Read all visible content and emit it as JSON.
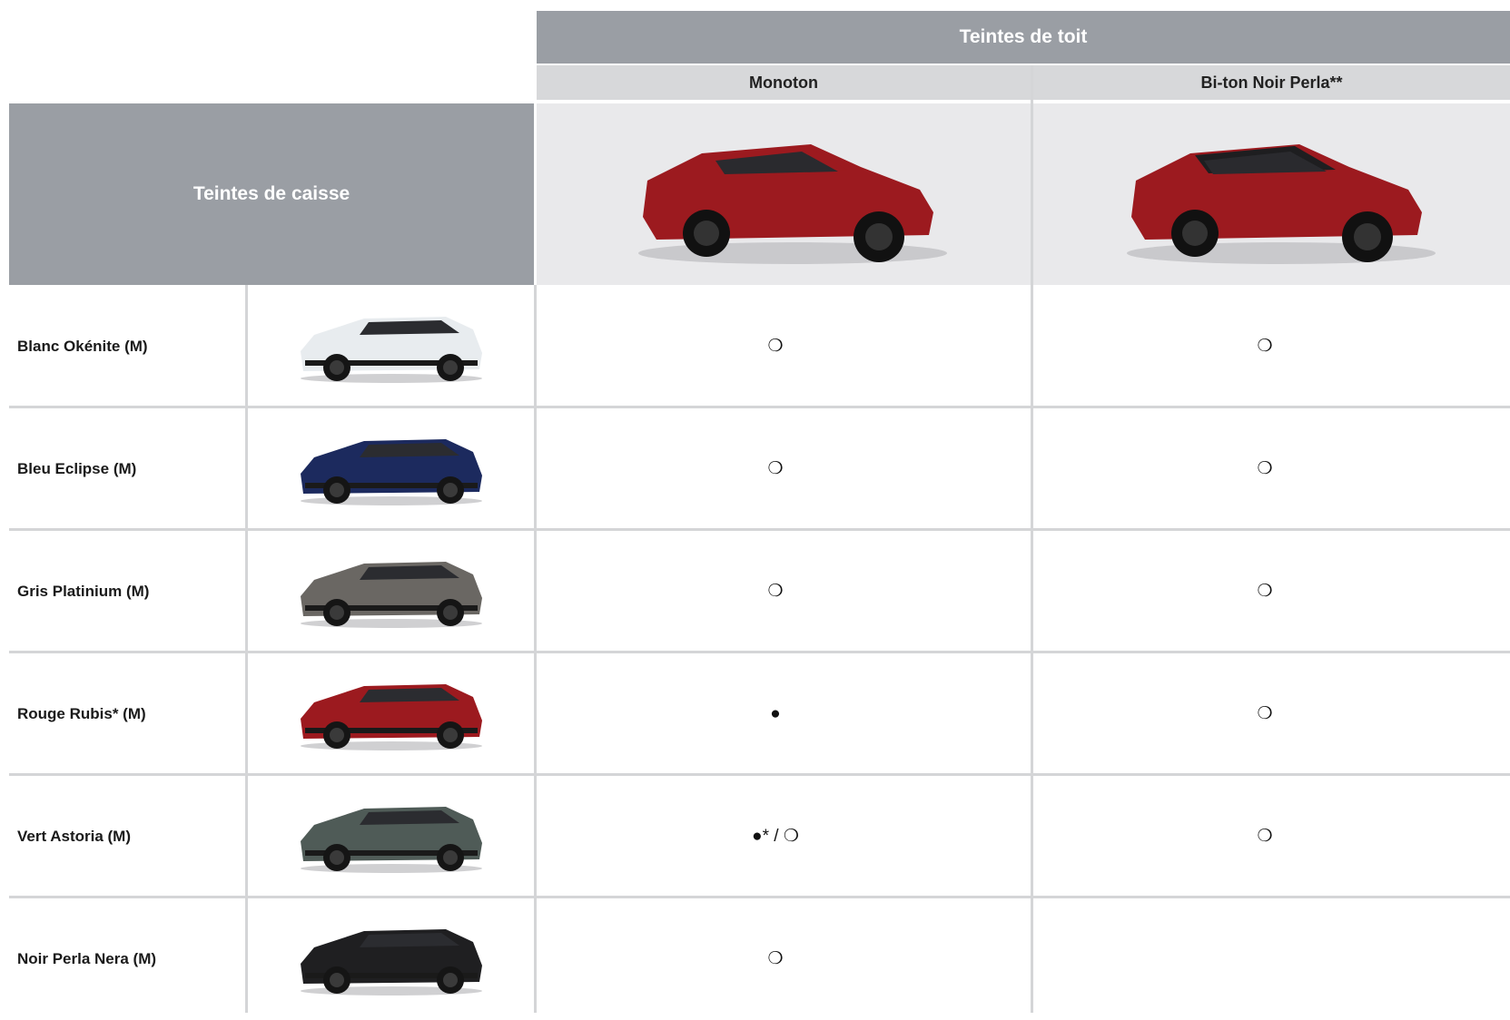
{
  "header": {
    "group_title": "Teintes de toit",
    "columns": [
      "Monoton",
      "Bi-ton Noir Perla**"
    ],
    "body_title": "Teintes de caisse"
  },
  "hero_cars": [
    {
      "body_color": "#9c1a1f",
      "roof_color": "#9c1a1f"
    },
    {
      "body_color": "#9c1a1f",
      "roof_color": "#1e1e20"
    }
  ],
  "rows": [
    {
      "label": "Blanc Okénite (M)",
      "body_color": "#e8ecef",
      "monoton": "❍",
      "biton": "❍"
    },
    {
      "label": "Bleu Eclipse (M)",
      "body_color": "#1c2a5e",
      "monoton": "❍",
      "biton": "❍"
    },
    {
      "label": "Gris Platinium (M)",
      "body_color": "#6a6763",
      "monoton": "❍",
      "biton": "❍"
    },
    {
      "label": "Rouge Rubis* (M)",
      "body_color": "#9c1a1f",
      "monoton": "●",
      "biton": "❍"
    },
    {
      "label": "Vert Astoria (M)",
      "body_color": "#4f5b57",
      "monoton": "●* / ❍",
      "biton": "❍"
    },
    {
      "label": "Noir Perla Nera (M)",
      "body_color": "#1f1f21",
      "monoton": "❍",
      "biton": ""
    }
  ]
}
